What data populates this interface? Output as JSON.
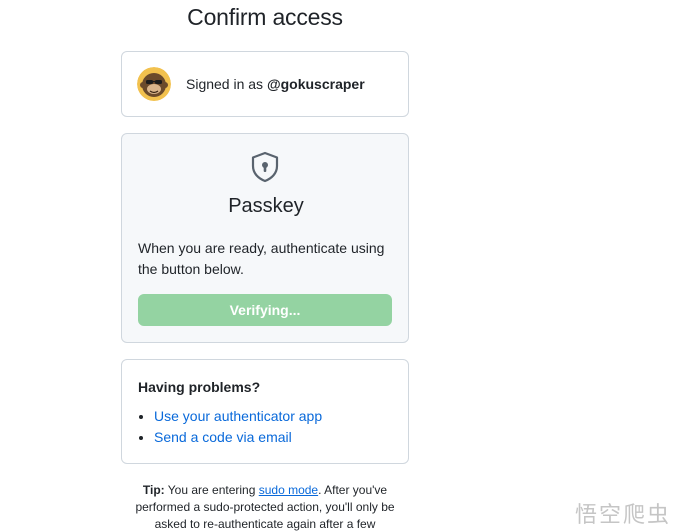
{
  "header": {
    "title": "Confirm access"
  },
  "account": {
    "signed_in_prefix": "Signed in as ",
    "username": "@gokuscraper",
    "avatar_icon": "monkey-avatar"
  },
  "passkey": {
    "icon": "shield-keyhole-icon",
    "title": "Passkey",
    "description": "When you are ready, authenticate using the button below.",
    "button_label": "Verifying..."
  },
  "problems": {
    "title": "Having problems?",
    "links": [
      "Use your authenticator app",
      "Send a code via email"
    ]
  },
  "tip": {
    "label": "Tip:",
    "text_before": " You are entering ",
    "link": "sudo mode",
    "text_after": ". After you've performed a sudo-protected action, you'll only be asked to re-authenticate again after a few"
  },
  "watermark": "悟空爬虫",
  "colors": {
    "accent_link": "#0969da",
    "button_disabled_green": "#94d3a2",
    "panel_bg": "#f6f8fa",
    "border": "#d0d7de"
  }
}
